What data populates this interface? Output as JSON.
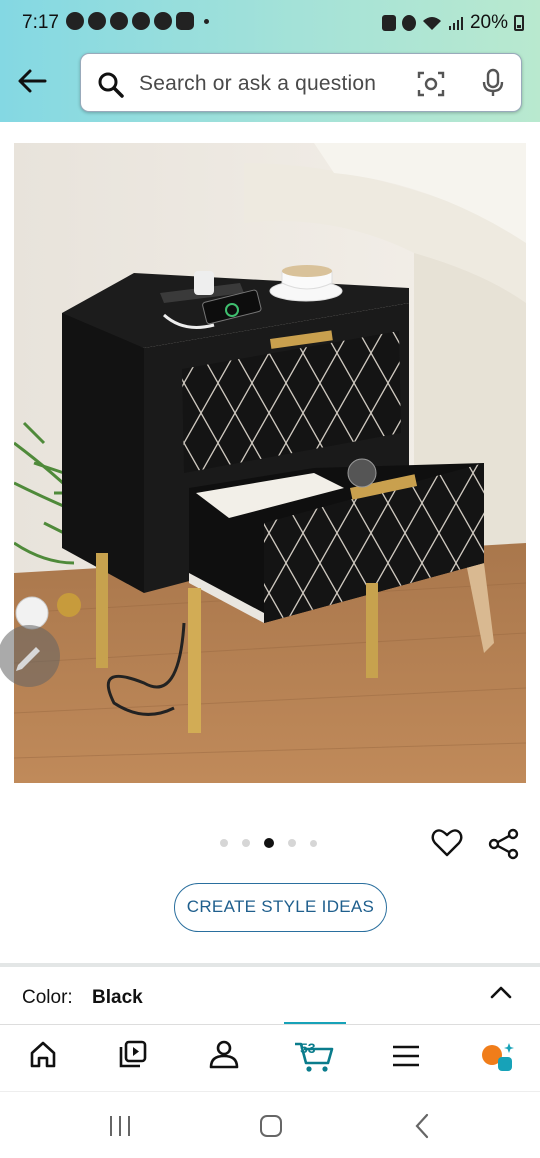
{
  "status_bar": {
    "time": "7:17",
    "battery": "20%",
    "notification_icons": [
      "messenger-icon",
      "messenger-icon",
      "messenger-icon",
      "whatsapp-icon",
      "snapchat-icon",
      "instagram-icon"
    ]
  },
  "search": {
    "placeholder": "Search or ask a question"
  },
  "gallery": {
    "image_subject": "black two-drawer nightstand with gold legs and charging station",
    "total_images": 5,
    "active_index": 2
  },
  "actions": {
    "create_style_ideas": "CREATE STYLE IDEAS"
  },
  "variation": {
    "label": "Color:",
    "value": "Black"
  },
  "bottom_nav": {
    "cart_count": "53",
    "items": [
      "home-icon",
      "video-icon",
      "account-icon",
      "cart-icon",
      "menu-icon",
      "rufus-icon"
    ]
  },
  "colors": {
    "accent": "#17a2b8",
    "link": "#1f5f8d",
    "header_start": "#84d8e3",
    "header_end": "#b9e9cf"
  }
}
